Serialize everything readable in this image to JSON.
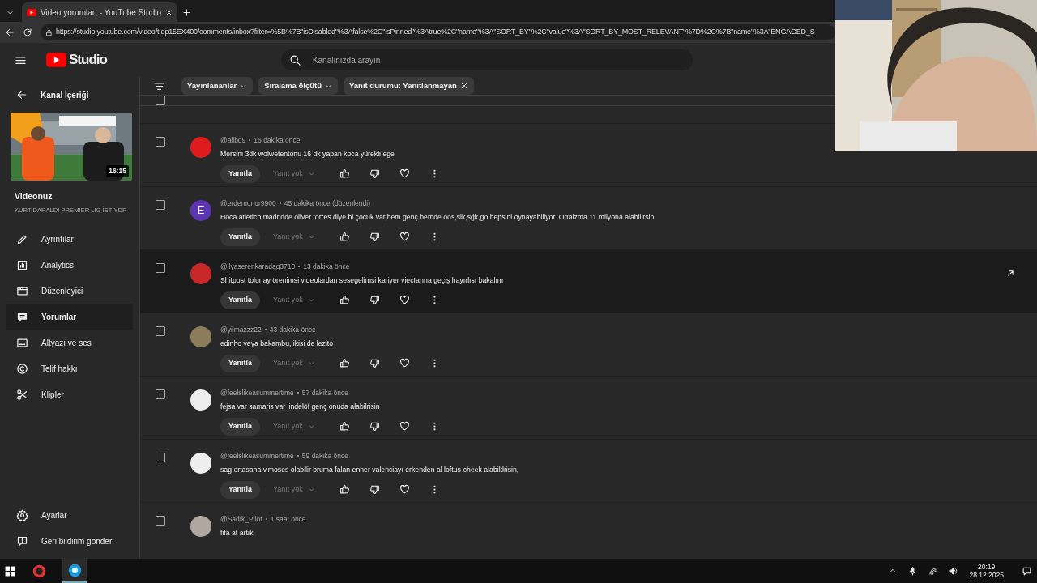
{
  "browser": {
    "tab_title": "Video yorumları - YouTube Studio",
    "url": "https://studio.youtube.com/video/tIqp15EX400/comments/inbox?filter=%5B%7B\"isDisabled\"%3Afalse%2C\"isPinned\"%3Atrue%2C\"name\"%3A\"SORT_BY\"%2C\"value\"%3A\"SORT_BY_MOST_RELEVANT\"%7D%2C%7B\"name\"%3A\"ENGAGED_S"
  },
  "header": {
    "logo": "Studio",
    "search": {
      "placeholder": "Kanalınızda arayın"
    }
  },
  "sidebar": {
    "back": "Kanal İçeriği",
    "video": {
      "duration": "16:15",
      "label": "Videonuz",
      "title": "KURT DARALDI PREMIER LIG İSTIYDR"
    },
    "items": [
      {
        "label": "Ayrıntılar",
        "selected": false
      },
      {
        "label": "Analytics",
        "selected": false
      },
      {
        "label": "Düzenleyici",
        "selected": false
      },
      {
        "label": "Yorumlar",
        "selected": true
      },
      {
        "label": "Altyazı ve ses",
        "selected": false
      },
      {
        "label": "Telif hakkı",
        "selected": false
      },
      {
        "label": "Klipler",
        "selected": false
      }
    ],
    "footer": [
      {
        "label": "Ayarlar"
      },
      {
        "label": "Geri bildirim gönder"
      }
    ]
  },
  "select_all": {
    "checked": false
  },
  "filters": [
    {
      "kind": "dropdown",
      "label": "Yayınlananlar"
    },
    {
      "kind": "dropdown",
      "label": "Sıralama ölçütü"
    },
    {
      "kind": "removable",
      "label": "Yanıt durumu: Yanıtlanmayan"
    }
  ],
  "comments": [
    {
      "author": "@alibd9",
      "time": "16 dakika önce",
      "text": "Mersini 3dk wolwetentonu 16 dk yapan koca yürekli ege",
      "hovered": false,
      "reply": "Yanıtla",
      "replies": "Yanıt yok"
    },
    {
      "author": "@erdemonur9900",
      "time": "45 dakika önce (düzenlendi)",
      "text": "Hoca atletico madridde oliver torres diye bi çocuk var,hem genç hemde oos,slk,sğk,gö hepsini oynayabiliyor. Ortalzma 11 milyona alabilirsin",
      "avatar": {
        "kind": "letter",
        "letter": "E",
        "color": "#5e35b1"
      },
      "hovered": false,
      "reply": "Yanıtla",
      "replies": "Yanıt yok"
    },
    {
      "author": "@ilyaserenkaradag3710",
      "time": "13 dakika önce",
      "text": "Shitpost tolunay örenimsi videolardan sesegelimsi kariyer viecIarına geçiş hayırlısı bakalım",
      "hovered": true,
      "reply": "Yanıtla",
      "replies": "Yanıt yok"
    },
    {
      "author": "@yilmazzz22",
      "time": "43 dakika önce",
      "text": "edinho veya bakambu, ikisi de lezito",
      "hovered": false,
      "reply": "Yanıtla",
      "replies": "Yanıt yok"
    },
    {
      "author": "@feelslikeasummertime",
      "time": "57 dakika önce",
      "text": "fejsa var samaris var lindelöf genç onuda alabilrisin",
      "hovered": false,
      "reply": "Yanıtla",
      "replies": "Yanıt yok"
    },
    {
      "author": "@feelslikeasummertime",
      "time": "59 dakika önce",
      "text": "sag ortasaha v.moses olabilir bruma falan enner valenciayı erkenden al loftus-cheek alabiklrisin,",
      "hovered": false,
      "reply": "Yanıtla",
      "replies": "Yanıt yok"
    },
    {
      "author": "@Sadık_Pilot",
      "time": "1 saat önce",
      "text": "fifa at artık",
      "hovered": false
    }
  ],
  "taskbar": {
    "time": "20:19",
    "date": "28.12.2025"
  }
}
